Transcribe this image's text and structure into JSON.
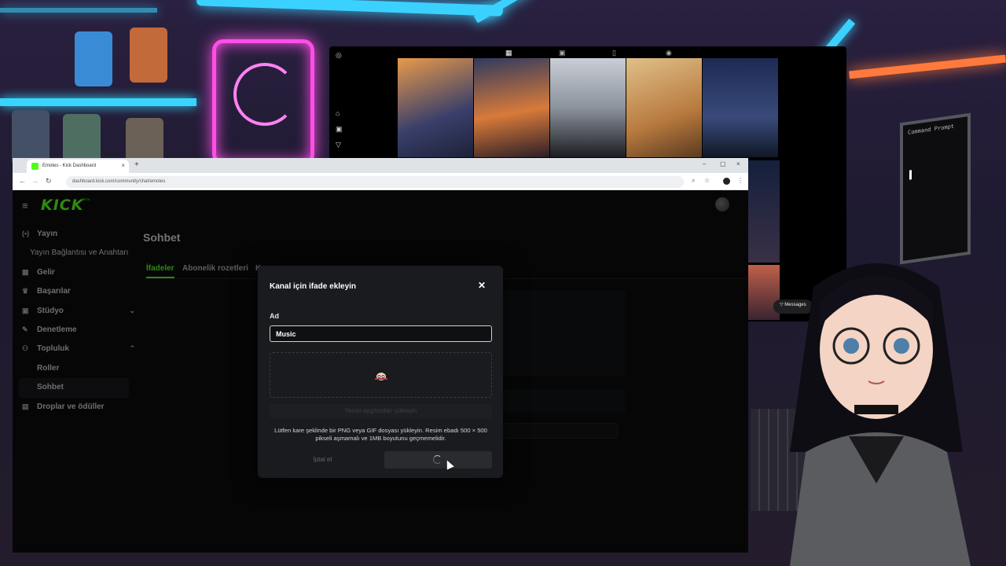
{
  "browser": {
    "tab_title": "Emotes - Kick Dashboard",
    "tab_close": "×",
    "new_tab": "+",
    "url": "dashboard.kick.com/community/chat/emotes",
    "win_min": "–",
    "win_max": "▢",
    "win_close": "×"
  },
  "kick": {
    "logo": "KICK",
    "logo_badge": "BETA",
    "page_title": "Sohbet",
    "sidebar": [
      {
        "label": "Yayın",
        "icon": "broadcast-icon",
        "glyph": "(•)"
      },
      {
        "label": "Yayın Bağlantısı ve Anahtarı",
        "icon": "",
        "glyph": ""
      },
      {
        "label": "Gelir",
        "icon": "revenue-icon",
        "glyph": "▦"
      },
      {
        "label": "Başarılar",
        "icon": "trophy-icon",
        "glyph": "♛"
      },
      {
        "label": "Stüdyo",
        "icon": "studio-icon",
        "glyph": "▣"
      },
      {
        "label": "Denetleme",
        "icon": "wrench-icon",
        "glyph": "✎"
      },
      {
        "label": "Topluluk",
        "icon": "community-icon",
        "glyph": "⚇"
      },
      {
        "label": "Roller",
        "icon": "",
        "glyph": ""
      },
      {
        "label": "Sohbet",
        "icon": "",
        "glyph": ""
      },
      {
        "label": "Droplar ve ödüller",
        "icon": "gift-icon",
        "glyph": "▤"
      }
    ],
    "tabs": [
      "İfadeler",
      "Abonelik rozetleri",
      "K"
    ]
  },
  "modal": {
    "title": "Kanal için ifade ekleyin",
    "close_glyph": "✕",
    "name_label": "Ad",
    "name_value": "Music",
    "upload_label": "Yenisi aygıtından yükleyin",
    "help_text": "Lütfen kare şeklinde bir PNG veya GIF dosyası yükleyin. Resim ebadı 500 × 500 pikseli aşmamalı ve 1MB boyutunu geçmemelidir.",
    "cancel_label": "İptal et"
  },
  "instagram": {
    "messages_label": "Messages"
  },
  "terminal": {
    "title": "Command Prompt",
    "prompt": ">"
  },
  "colors": {
    "kick_green": "#53fc18",
    "neon_blue": "#3bd1ff",
    "neon_pink": "#ff4ee8"
  }
}
